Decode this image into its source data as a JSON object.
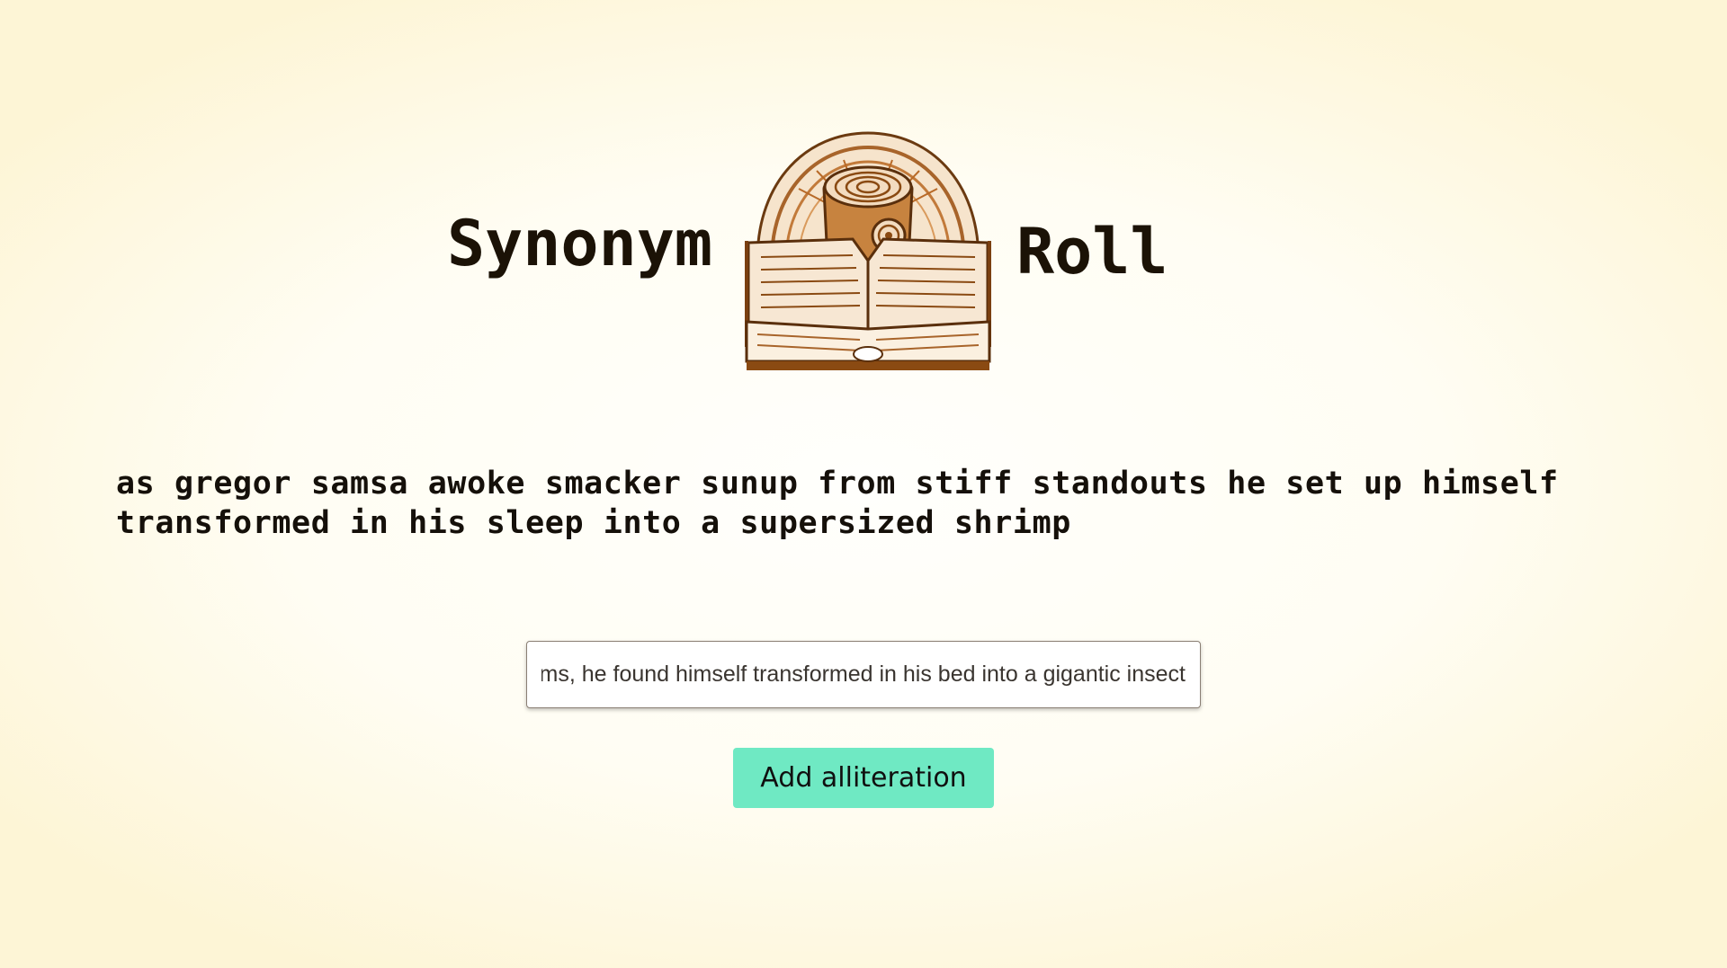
{
  "header": {
    "title_left": "Synonym",
    "title_right": "Roll",
    "logo_icon": "book-with-cinnamon-roll-icon"
  },
  "output": {
    "text": "as gregor samsa awoke smacker sunup from stiff standouts he set up himself transformed in his sleep into a supersized shrimp"
  },
  "input": {
    "value": "One morning, as Gregor Samsa was waking up from anxious dreams, he found himself transformed in his bed into a gigantic insect."
  },
  "button": {
    "label": "Add alliteration",
    "color": "#6fe9c3"
  },
  "colors": {
    "logo_brown": "#8a4a12",
    "text": "#1b1206"
  }
}
